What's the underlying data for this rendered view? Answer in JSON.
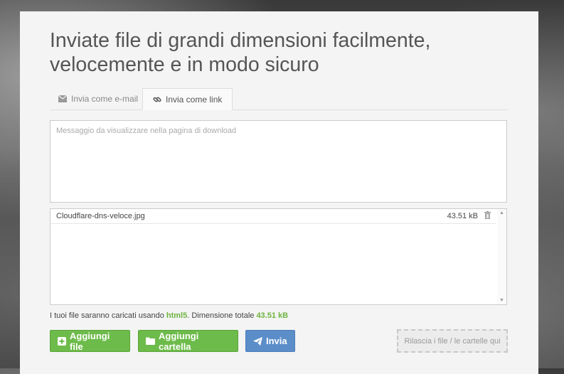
{
  "header": {
    "headline_line1": "Inviate file di grandi dimensioni facilmente,",
    "headline_line2": "velocemente e in modo sicuro"
  },
  "tabs": [
    {
      "label": "Invia come e-mail",
      "icon": "envelope-icon",
      "active": false
    },
    {
      "label": "Invia come link",
      "icon": "link-icon",
      "active": true
    }
  ],
  "message": {
    "placeholder": "Messaggio da visualizzare nella pagina di download",
    "value": ""
  },
  "files": [
    {
      "name": "Cloudflare-dns-veloce.jpg",
      "size": "43.51 kB"
    }
  ],
  "info": {
    "prefix": "I tuoi file saranno caricati usando ",
    "method": "html5",
    "middle": ". Dimensione totale ",
    "total": "43.51 kB"
  },
  "buttons": {
    "add_file": "Aggiungi file",
    "add_folder": "Aggiungi cartella",
    "send": "Invia"
  },
  "dropzone": {
    "label": "Rilascia i file / le cartelle qui"
  },
  "colors": {
    "green": "#6dbb4a",
    "blue": "#5b8ec9",
    "highlight": "#6db33f"
  }
}
